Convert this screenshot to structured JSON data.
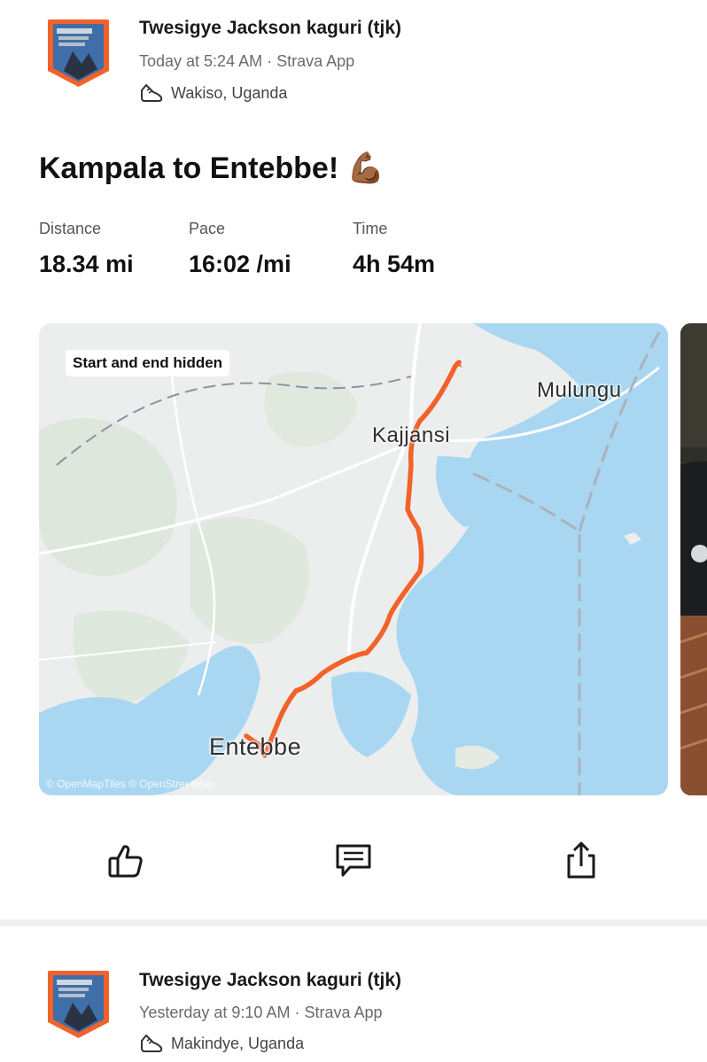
{
  "posts": [
    {
      "author": "Twesigye Jackson  kaguri (tjk)",
      "meta": "Today at 5:24 AM · Strava App",
      "location": "Wakiso, Uganda",
      "title": "Kampala to Entebbe! 💪🏾",
      "stats": [
        {
          "label": "Distance",
          "value": "18.34 mi"
        },
        {
          "label": "Pace",
          "value": "16:02 /mi"
        },
        {
          "label": "Time",
          "value": "4h 54m"
        }
      ],
      "map": {
        "badge": "Start and end hidden",
        "labels": {
          "mulungu": "Mulungu",
          "kajjansi": "Kajjansi",
          "entebbe": "Entebbe"
        },
        "attribution": "© OpenMapTiles © OpenStreetMap",
        "route_color": "#f2622a"
      },
      "actions": {
        "like_icon": "thumbs-up-icon",
        "comment_icon": "comment-icon",
        "share_icon": "share-icon"
      }
    },
    {
      "author": "Twesigye Jackson  kaguri (tjk)",
      "meta": "Yesterday at 9:10 AM · Strava App",
      "location": "Makindye, Uganda"
    }
  ],
  "colors": {
    "accent": "#f2622a",
    "water": "#a9d7f2",
    "land": "#eef0ef"
  }
}
